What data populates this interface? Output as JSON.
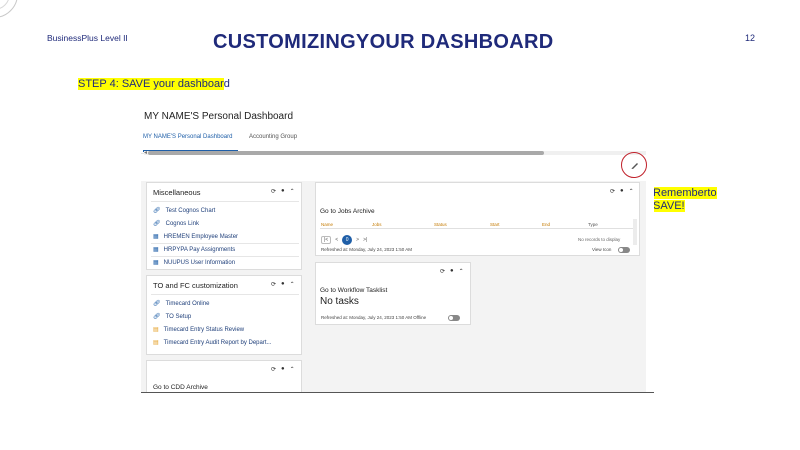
{
  "slide": {
    "course": "BusinessPlus Level II",
    "title": "CUSTOMIZINGYOUR  DASHBOARD",
    "page_number": "12",
    "step_highlight": "STEP 4: SAVE your dashboar",
    "step_rest": "d",
    "remember_line1": "Remembe",
    "remember_line1b": "r",
    "remember_line1c": "to",
    "remember_line2": "SAVE!"
  },
  "dashboard": {
    "title": "MY NAME'S Personal Dashboard",
    "tabs": [
      "MY NAME'S Personal Dashboard",
      "Accounting Group"
    ],
    "scroll_left_arrow": "◂",
    "edit_icon": "pencil-icon",
    "controls": {
      "refresh": "⟳",
      "info": "●",
      "collapse": "⌃"
    }
  },
  "panels": {
    "misc": {
      "title": "Miscellaneous",
      "items": [
        {
          "icon": "link-icon",
          "label": "Test Cognos Chart"
        },
        {
          "icon": "link-icon",
          "label": "Cognos Link"
        },
        {
          "icon": "grid-icon",
          "label": "HREMEN Employee Master"
        },
        {
          "icon": "grid-icon",
          "label": "HRPYPA Pay Assignments"
        },
        {
          "icon": "grid-icon",
          "label": "NUUPUS User Information"
        }
      ]
    },
    "to": {
      "title": "TO and FC customization",
      "items": [
        {
          "icon": "link-icon",
          "label": "Timecard Online"
        },
        {
          "icon": "link-icon",
          "label": "TO Setup"
        },
        {
          "icon": "report-icon",
          "label": "Timecard Entry Status Review"
        },
        {
          "icon": "report-icon",
          "label": "Timecard Entry Audit Report by Depart..."
        }
      ]
    },
    "cdd": {
      "title": "Go to CDD Archive"
    },
    "jobs": {
      "link": "Go to Jobs Archive",
      "columns": [
        "Name",
        "Jobs",
        "Status",
        "Start",
        "End",
        "Type"
      ],
      "pager": {
        "first": "|<",
        "prev": "<",
        "current": "0",
        "next": ">",
        "last": ">|"
      },
      "no_records": "No records to display",
      "refreshed": "Refreshed at: Monday, July 24, 2023 1:50 AM",
      "view_icon": "View Icon"
    },
    "workflow": {
      "link": "Go to Workflow Tasklist",
      "empty": "No tasks",
      "refreshed": "Refreshed at: Monday, July 24, 2023 1:50 AM  Offline"
    }
  }
}
